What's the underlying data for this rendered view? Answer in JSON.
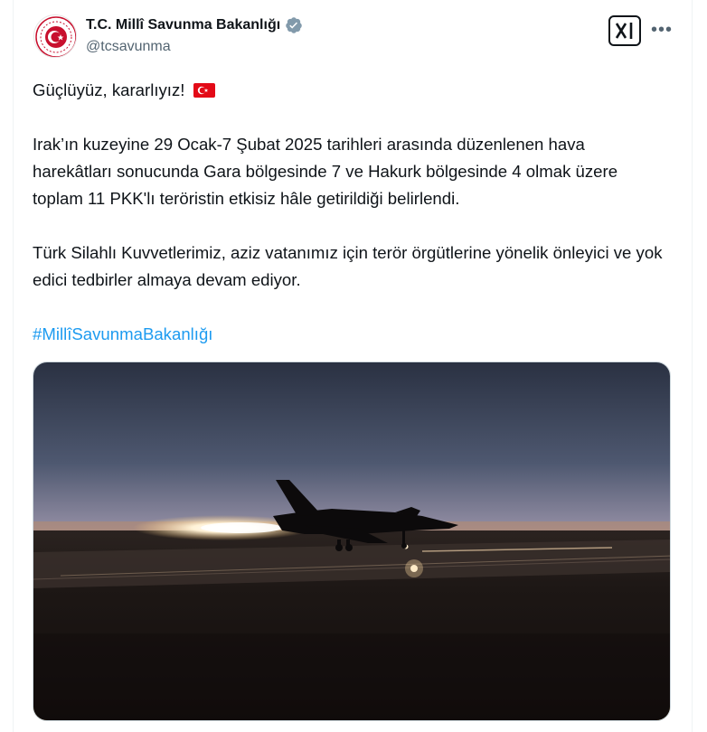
{
  "account": {
    "display_name": "T.C. Millî Savunma Bakanlığı",
    "handle": "@tcsavunma",
    "verified_icon": "verified-badge-icon",
    "avatar_icon": "ministry-emblem-icon"
  },
  "actions": {
    "grok_icon": "grok-icon",
    "more_icon": "more-icon"
  },
  "tweet": {
    "line1": "Güçlüyüz, kararlıyız!",
    "flag_icon": "turkish-flag-icon",
    "paragraph2": "Irak’ın kuzeyine 29 Ocak-7 Şubat 2025 tarihleri arasında düzenlenen hava harekâtları sonucunda Gara bölgesinde 7 ve Hakurk bölgesinde 4 olmak üzere toplam 11 PKK'lı teröristin etkisiz hâle getirildiği belirlendi.",
    "paragraph3": "Türk Silahlı Kuvvetlerimiz, aziz vatanımız için terör örgütlerine yönelik önleyici ve yok edici tedbirler almaya devam ediyor.",
    "hashtag": "#MillîSavunmaBakanlığı"
  },
  "media": {
    "icon": "fighter-jet-photo"
  },
  "colors": {
    "text": "#0f1419",
    "secondary": "#536471",
    "link": "#1d9bf0",
    "verified": "#829aab",
    "flag_red": "#e30a17"
  }
}
